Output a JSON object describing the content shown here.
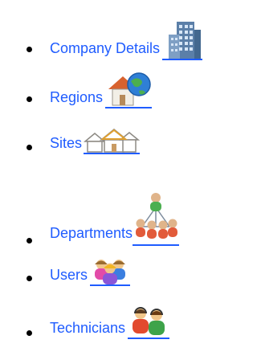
{
  "nav": {
    "items": [
      {
        "label": "Company Details",
        "icon": "building-icon"
      },
      {
        "label": "Regions",
        "icon": "globe-house-icon"
      },
      {
        "label": "Sites",
        "icon": "houses-icon"
      },
      {
        "label": "Departments",
        "icon": "org-people-icon"
      },
      {
        "label": "Users",
        "icon": "users-group-icon"
      },
      {
        "label": "Technicians",
        "icon": "technicians-icon"
      }
    ]
  },
  "colors": {
    "link": "#1f5cff",
    "bullet": "#000000",
    "background": "#ffffff"
  }
}
